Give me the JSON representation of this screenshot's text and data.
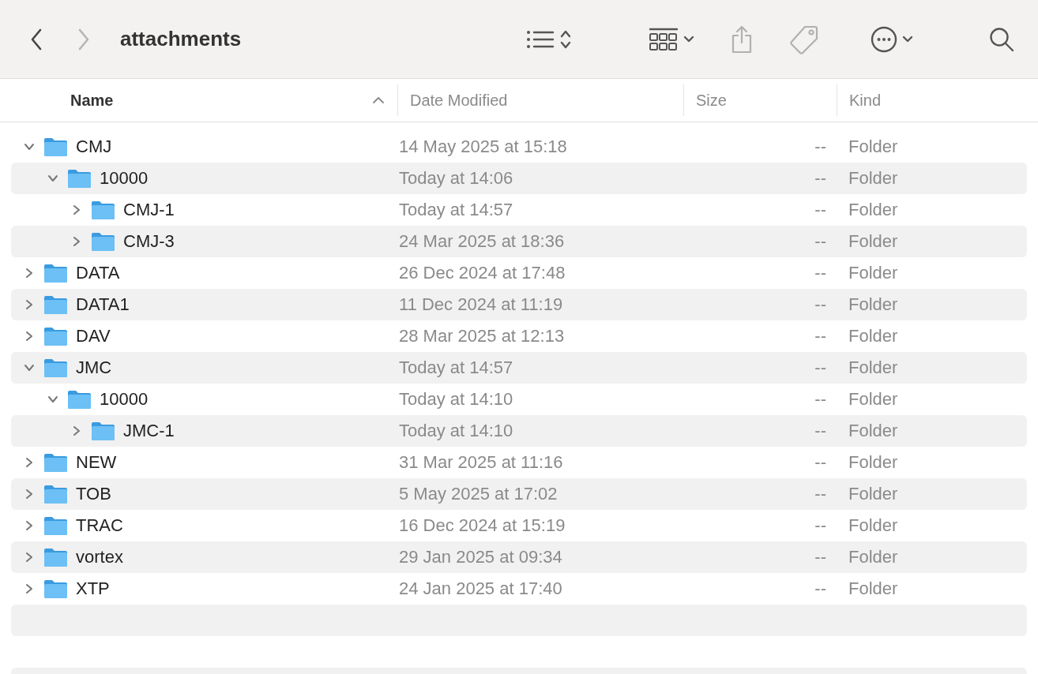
{
  "window": {
    "title": "attachments"
  },
  "toolbar": {
    "back_enabled": true,
    "forward_enabled": false,
    "share_enabled": false,
    "tag_enabled": false
  },
  "columns": [
    {
      "label": "Name",
      "sorted": true
    },
    {
      "label": "Date Modified",
      "sorted": false
    },
    {
      "label": "Size",
      "sorted": false
    },
    {
      "label": "Kind",
      "sorted": false
    }
  ],
  "rows": [
    {
      "name": "CMJ",
      "date": "14 May 2025 at 15:18",
      "size": "--",
      "kind": "Folder",
      "expanded": true,
      "children": [
        {
          "name": "10000",
          "date": "Today at 14:06",
          "size": "--",
          "kind": "Folder",
          "expanded": true,
          "children": [
            {
              "name": "CMJ-1",
              "date": "Today at 14:57",
              "size": "--",
              "kind": "Folder",
              "expanded": false
            },
            {
              "name": "CMJ-3",
              "date": "24 Mar 2025 at 18:36",
              "size": "--",
              "kind": "Folder",
              "expanded": false
            }
          ]
        }
      ]
    },
    {
      "name": "DATA",
      "date": "26 Dec 2024 at 17:48",
      "size": "--",
      "kind": "Folder",
      "expanded": false
    },
    {
      "name": "DATA1",
      "date": "11 Dec 2024 at 11:19",
      "size": "--",
      "kind": "Folder",
      "expanded": false
    },
    {
      "name": "DAV",
      "date": "28 Mar 2025 at 12:13",
      "size": "--",
      "kind": "Folder",
      "expanded": false
    },
    {
      "name": "JMC",
      "date": "Today at 14:57",
      "size": "--",
      "kind": "Folder",
      "expanded": true,
      "children": [
        {
          "name": "10000",
          "date": "Today at 14:10",
          "size": "--",
          "kind": "Folder",
          "expanded": true,
          "children": [
            {
              "name": "JMC-1",
              "date": "Today at 14:10",
              "size": "--",
              "kind": "Folder",
              "expanded": false
            }
          ]
        }
      ]
    },
    {
      "name": "NEW",
      "date": "31 Mar 2025 at 11:16",
      "size": "--",
      "kind": "Folder",
      "expanded": false
    },
    {
      "name": "TOB",
      "date": "5 May 2025 at 17:02",
      "size": "--",
      "kind": "Folder",
      "expanded": false
    },
    {
      "name": "TRAC",
      "date": "16 Dec 2024 at 15:19",
      "size": "--",
      "kind": "Folder",
      "expanded": false
    },
    {
      "name": "vortex",
      "date": "29 Jan 2025 at 09:34",
      "size": "--",
      "kind": "Folder",
      "expanded": false
    },
    {
      "name": "XTP",
      "date": "24 Jan 2025 at 17:40",
      "size": "--",
      "kind": "Folder",
      "expanded": false
    }
  ]
}
